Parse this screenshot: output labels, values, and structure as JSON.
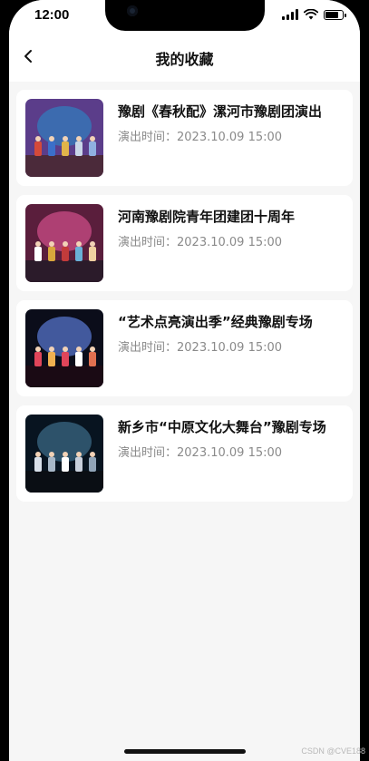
{
  "status_bar": {
    "time": "12:00",
    "icons": [
      "signal-icon",
      "wifi-icon",
      "battery-icon"
    ],
    "battery_level": 0.85
  },
  "nav": {
    "back_icon": "chevron-left-icon",
    "title": "我的收藏"
  },
  "favorites": [
    {
      "title": "豫剧《春秋配》漯河市豫剧团演出",
      "time": "演出时间：2023.10.09 15:00",
      "thumbnail": "opera-stage-photo"
    },
    {
      "title": "河南豫剧院青年团建团十周年",
      "time": "演出时间：2023.10.09 15:00",
      "thumbnail": "opera-stage-photo"
    },
    {
      "title": "“艺术点亮演出季”经典豫剧专场",
      "time": "演出时间：2023.10.09 15:00",
      "thumbnail": "opera-stage-photo"
    },
    {
      "title": "新乡市“中原文化大舞台”豫剧专场",
      "time": "演出时间：2023.10.09 15:00",
      "thumbnail": "opera-stage-photo"
    }
  ],
  "watermark": "CSDN @CVE188",
  "colors": {
    "background": "#f6f6f6",
    "card": "#ffffff",
    "title_text": "#111111",
    "time_text": "#8a8a8a"
  }
}
